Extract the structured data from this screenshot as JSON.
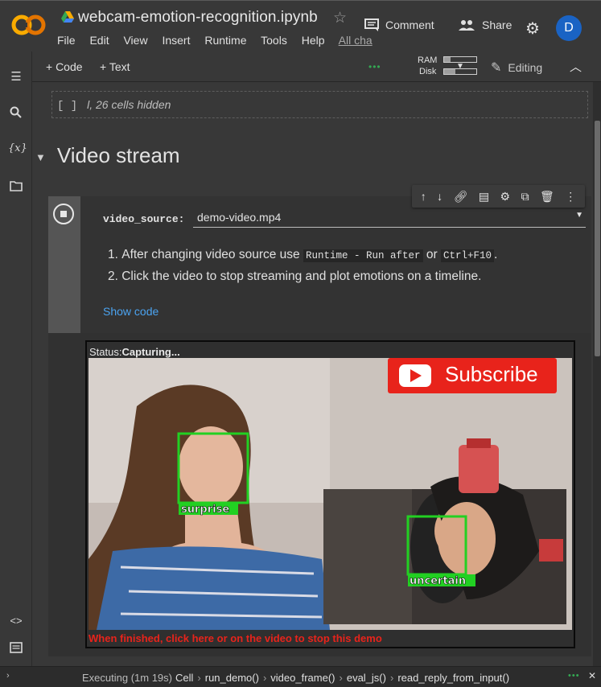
{
  "app": {
    "notebook_title": "webcam-emotion-recognition.ipynb",
    "menu": [
      "File",
      "Edit",
      "View",
      "Insert",
      "Runtime",
      "Tools",
      "Help"
    ],
    "all_changes_label": "All cha",
    "comment_label": "Comment",
    "share_label": "Share",
    "avatar_initial": "D",
    "brand_colors": {
      "logo_orange": "#f9ab00",
      "avatar_blue": "#1a63c4",
      "link_blue": "#4ba3f0",
      "status_green": "#34a853",
      "warning_red": "#e8231b"
    }
  },
  "toolbar": {
    "add_code_label": "+ Code",
    "add_text_label": "+ Text",
    "ram_label": "RAM",
    "disk_label": "Disk",
    "ram_fraction": 0.2,
    "disk_fraction": 0.35,
    "editing_label": "Editing"
  },
  "sidebar_icons": [
    "table-of-contents-icon",
    "search-icon",
    "variables-icon",
    "files-icon",
    "code-snippets-icon",
    "terminal-icon"
  ],
  "hidden_cells": {
    "bracket": "[ ]",
    "text": "l, 26 cells hidden"
  },
  "section": {
    "title": "Video stream"
  },
  "cell": {
    "form_label": "video_source:",
    "video_source_value": "demo-video.mp4",
    "step1_prefix": "After changing video source use",
    "step1_code1": "Runtime - Run after",
    "step1_mid": "or",
    "step1_code2": "Ctrl+F10",
    "step1_suffix": ".",
    "step2": "Click the video to stop streaming and plot emotions on a timeline.",
    "show_code_label": "Show code"
  },
  "output": {
    "status_label": "Status:",
    "status_value": "Capturing...",
    "subscribe_label": "Subscribe",
    "face_labels": [
      "surprise",
      "uncertain"
    ],
    "finish_message": "When finished, click here or on the video to stop this demo"
  },
  "statusbar": {
    "executing": "Executing (1m 19s)",
    "path": [
      "Cell",
      "run_demo()",
      "video_frame()",
      "eval_js()",
      "read_reply_from_input()"
    ]
  }
}
